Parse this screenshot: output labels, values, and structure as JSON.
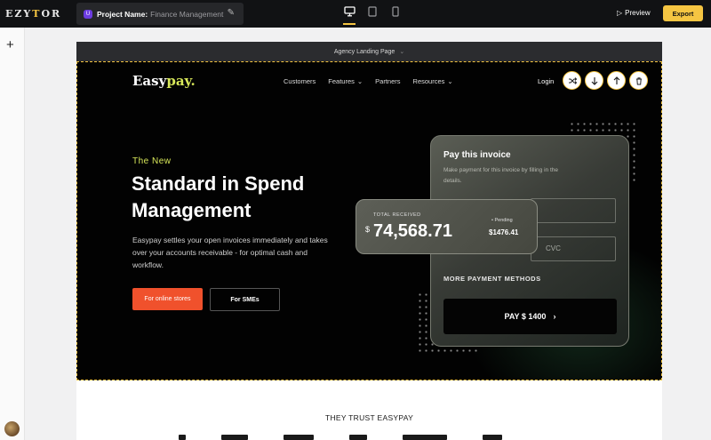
{
  "app": {
    "logo_pre": "EZY",
    "logo_accent": "T",
    "logo_post": "OR",
    "project_badge": "U",
    "project_label": "Project Name:",
    "project_name": "Finance Management",
    "preview_label": "Preview",
    "export_label": "Export",
    "accent_color": "#f5c542"
  },
  "canvas": {
    "page_label": "Agency Landing Page"
  },
  "site": {
    "brand_main": "Easy",
    "brand_accent": "pay.",
    "nav": [
      "Customers",
      "Features",
      "Partners",
      "Resources"
    ],
    "login": "Login",
    "tagline": "The New",
    "headline": "Standard in Spend Management",
    "description": "Easypay settles your open invoices immediately and takes over your accounts receivable - for optimal cash and workflow.",
    "cta_primary": "For online stores",
    "cta_secondary": "For SMEs",
    "cta_color": "#f0512c",
    "brand_accent_color": "#d8e85a"
  },
  "invoice": {
    "title": "Pay this invoice",
    "subtitle": "Make payment for this invoice by filling in the details.",
    "cvc_placeholder": "CVC",
    "more_methods": "MORE PAYMENT METHODS",
    "pay_label": "PAY $ 1400"
  },
  "received": {
    "label": "TOTAL RECEIVED",
    "currency": "$",
    "amount": "74,568.71",
    "pending_label": "Pending",
    "pending_value": "$1476.41"
  },
  "section": {
    "trust_title": "THEY TRUST EASYPAY"
  }
}
